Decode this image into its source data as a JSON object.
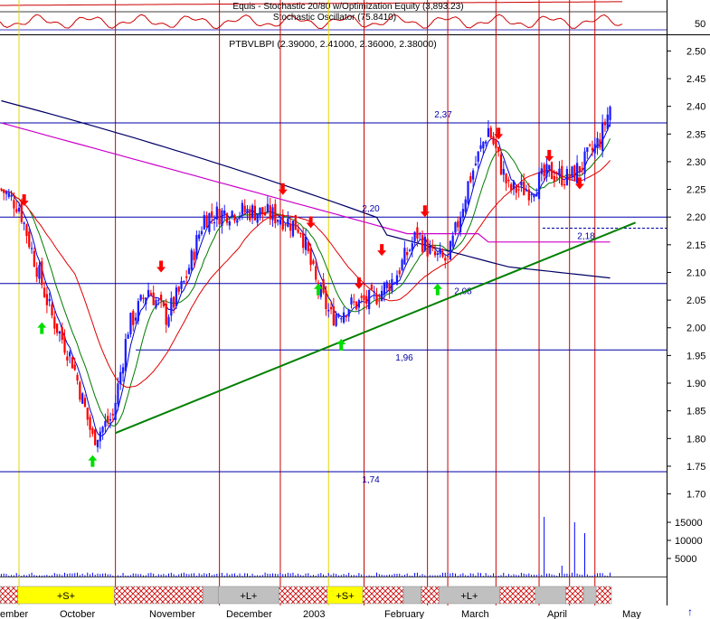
{
  "header": {
    "equity_label": "Equis - Stochastic 20/80  w/Optimization Equity (3,893.23)",
    "oscillator_label": "Stochastic Oscillator (75.8410)",
    "oscillator_level": "50"
  },
  "colors": {
    "price_up": "#1a1aff",
    "price_down": "#ff0000",
    "ma_fast": "#0000cc",
    "ma_green": "#007a00",
    "ma_red": "#e00000",
    "ma_magenta": "#cc00cc",
    "ma_navy": "#000066",
    "vline": "#cc0000",
    "yellow_vline": "#e6d400",
    "trendline": "#008000",
    "hline": "#0000aa",
    "buy_arrow": "#00dd00",
    "sell_arrow": "#ff0000",
    "volume": "#0000ff",
    "signal_yellow": "#ffff00",
    "signal_gray": "#c0c0c0",
    "signal_hatch": "#cc0000"
  },
  "chart_data": {
    "type": "candlestick",
    "title": "PTBVLBPI (2.39000, 2.41000, 2.36000, 2.38000)",
    "ylim": [
      1.665,
      2.53
    ],
    "y_ticks": [
      "2.50",
      "2.45",
      "2.40",
      "2.35",
      "2.30",
      "2.25",
      "2.20",
      "2.15",
      "2.10",
      "2.05",
      "2.00",
      "1.95",
      "1.90",
      "1.85",
      "1.80",
      "1.75",
      "1.70"
    ],
    "volume_ticks": [
      "15000",
      "10000",
      "5000"
    ],
    "x_labels": [
      "ember",
      "October",
      "November",
      "December",
      "2003",
      "February",
      "March",
      "April",
      "May"
    ],
    "levels": [
      {
        "value": 2.37,
        "label": "2,37"
      },
      {
        "value": 2.2,
        "label": "2,20"
      },
      {
        "value": 2.18,
        "label": "2,18"
      },
      {
        "value": 2.08,
        "label": "2,08"
      },
      {
        "value": 1.96,
        "label": "1,96"
      },
      {
        "value": 1.74,
        "label": "1,74"
      }
    ],
    "trendline": {
      "from": {
        "bar": 45,
        "value": 1.81
      },
      "to": {
        "bar": 250,
        "value": 2.19
      }
    },
    "signal_bar": [
      {
        "from": 0,
        "to": 7,
        "kind": "hatch",
        "label": ""
      },
      {
        "from": 7,
        "to": 45,
        "kind": "yellow",
        "label": "+S+"
      },
      {
        "from": 45,
        "to": 80,
        "kind": "hatch",
        "label": ""
      },
      {
        "from": 80,
        "to": 86,
        "kind": "gray",
        "label": ""
      },
      {
        "from": 86,
        "to": 110,
        "kind": "gray",
        "label": "+L+"
      },
      {
        "from": 110,
        "to": 129,
        "kind": "hatch",
        "label": ""
      },
      {
        "from": 129,
        "to": 143,
        "kind": "yellow",
        "label": "+S+"
      },
      {
        "from": 143,
        "to": 159,
        "kind": "hatch",
        "label": ""
      },
      {
        "from": 159,
        "to": 166,
        "kind": "gray",
        "label": ""
      },
      {
        "from": 166,
        "to": 173,
        "kind": "hatch",
        "label": ""
      },
      {
        "from": 173,
        "to": 197,
        "kind": "gray",
        "label": "+L+"
      },
      {
        "from": 197,
        "to": 211,
        "kind": "hatch",
        "label": ""
      },
      {
        "from": 211,
        "to": 223,
        "kind": "gray",
        "label": ""
      },
      {
        "from": 223,
        "to": 230,
        "kind": "hatch",
        "label": ""
      },
      {
        "from": 230,
        "to": 235,
        "kind": "gray",
        "label": ""
      },
      {
        "from": 235,
        "to": 241,
        "kind": "hatch",
        "label": ""
      },
      {
        "from": 241,
        "to": 236,
        "kind": "gray",
        "label": ""
      }
    ],
    "red_vlines": [
      45,
      86,
      110,
      143,
      168,
      176,
      195,
      212,
      224,
      234
    ],
    "yellow_vlines": [
      7,
      129,
      143
    ],
    "buy_arrows": [
      {
        "bar": 16,
        "value": 2.01
      },
      {
        "bar": 36,
        "value": 1.77
      },
      {
        "bar": 125,
        "value": 2.08
      },
      {
        "bar": 134,
        "value": 1.98
      },
      {
        "bar": 172,
        "value": 2.08
      }
    ],
    "sell_arrows": [
      {
        "bar": 9,
        "value": 2.22
      },
      {
        "bar": 63,
        "value": 2.1
      },
      {
        "bar": 111,
        "value": 2.24
      },
      {
        "bar": 122,
        "value": 2.18
      },
      {
        "bar": 141,
        "value": 2.07
      },
      {
        "bar": 150,
        "value": 2.13
      },
      {
        "bar": 167,
        "value": 2.2
      },
      {
        "bar": 196,
        "value": 2.34
      },
      {
        "bar": 216,
        "value": 2.3
      },
      {
        "bar": 228,
        "value": 2.25
      }
    ]
  }
}
